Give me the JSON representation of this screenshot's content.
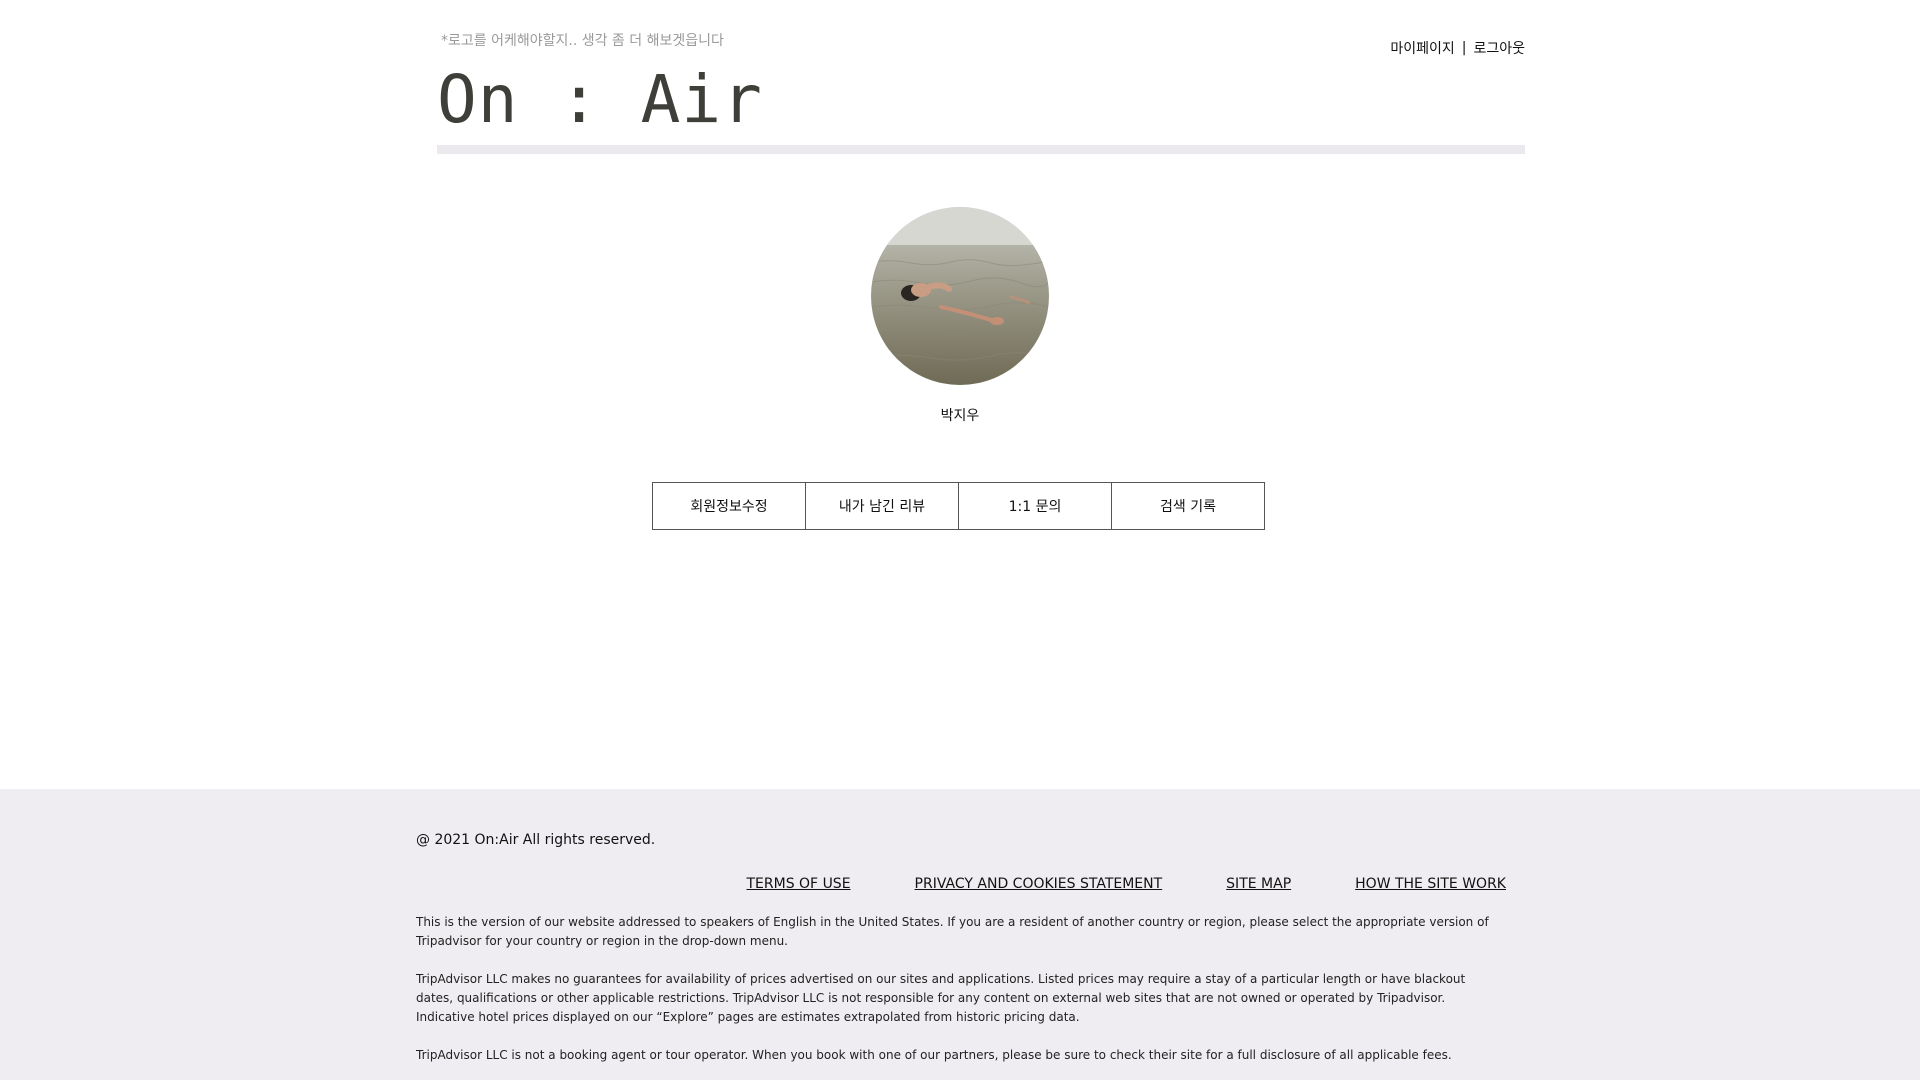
{
  "header": {
    "tagline": "*로고를 어케해야할지.. 생각 좀 더 해보겟읍니다",
    "logo": "On : Air",
    "links": {
      "mypage": "마이페이지",
      "separator": "|",
      "logout": "로그아웃"
    }
  },
  "profile": {
    "username": "박지우",
    "avatar_icon": "profile-photo-person-floating-in-water"
  },
  "tabs": [
    {
      "label": "회원정보수정"
    },
    {
      "label": "내가 남긴 리뷰"
    },
    {
      "label": "1:1 문의"
    },
    {
      "label": "검색 기록"
    }
  ],
  "footer": {
    "copyright": "@ 2021 On:Air All rights reserved.",
    "links": [
      {
        "label": "TERMS OF USE"
      },
      {
        "label": "PRIVACY AND COOKIES STATEMENT"
      },
      {
        "label": "SITE MAP"
      },
      {
        "label": "HOW THE SITE WORK"
      }
    ],
    "disclaimers": [
      "This is the version of our website addressed to speakers of English in the United States. If you are a resident of another country or region, please select the appropriate version of Tripadvisor for your country or region in the drop-down menu.",
      "TripAdvisor LLC makes no guarantees for availability of prices advertised on our sites and applications. Listed prices may require a stay of a particular length or have blackout dates, qualifications or other applicable restrictions. TripAdvisor LLC is not responsible for any content on external web sites that are not owned or operated by Tripadvisor. Indicative hotel prices displayed on our “Explore” pages are estimates extrapolated from historic pricing data.",
      "TripAdvisor LLC is not a booking agent or tour operator. When you book with one of our partners, please be sure to check their site for a full disclosure of all applicable fees."
    ]
  },
  "colors": {
    "header_bar": "#ebe9ed",
    "footer_bg": "#efedf1",
    "logo": "#3f3f3a",
    "tagline": "#9a9a9a"
  }
}
